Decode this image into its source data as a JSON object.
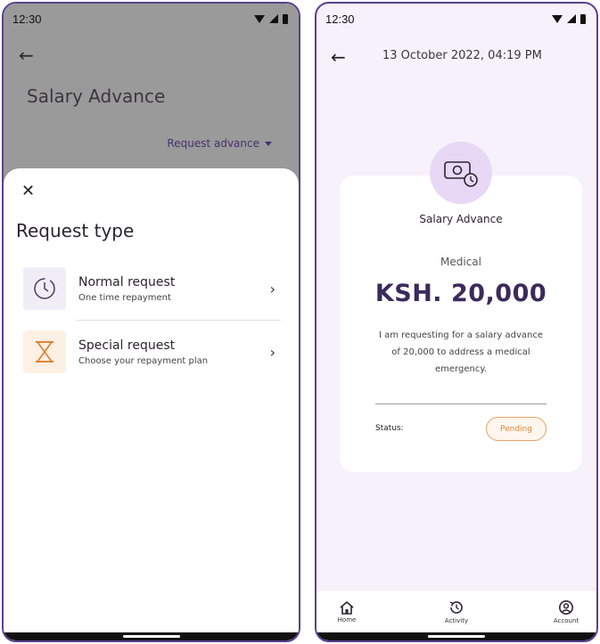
{
  "left_screen": {
    "status_time": "12:30",
    "page_title": "Salary Advance",
    "request_dropdown_label": "Request advance",
    "sheet": {
      "title": "Request type",
      "options": [
        {
          "title": "Normal request",
          "subtitle": "One time repayment",
          "icon": "clock-icon"
        },
        {
          "title": "Special request",
          "subtitle": "Choose your repayment plan",
          "icon": "hourglass-icon"
        }
      ]
    }
  },
  "right_screen": {
    "status_time": "12:30",
    "header_date": "13 October 2022, 04:19 PM",
    "card": {
      "title": "Salary Advance",
      "category": "Medical",
      "amount": "KSH. 20,000",
      "description": "I am requesting for a salary advance of 20,000 to address a medical emergency.",
      "status_label": "Status:",
      "status_value": "Pending",
      "icon": "cash-clock-icon"
    },
    "bottom_nav": [
      {
        "label": "Home",
        "icon": "home-icon"
      },
      {
        "label": "Activity",
        "icon": "history-icon"
      },
      {
        "label": "Account",
        "icon": "account-icon"
      }
    ]
  },
  "colors": {
    "brand_purple": "#3c2a5c",
    "accent_lavender": "#e8d8f5",
    "pending_orange": "#e0843a",
    "frame": "#5b3f8f"
  }
}
